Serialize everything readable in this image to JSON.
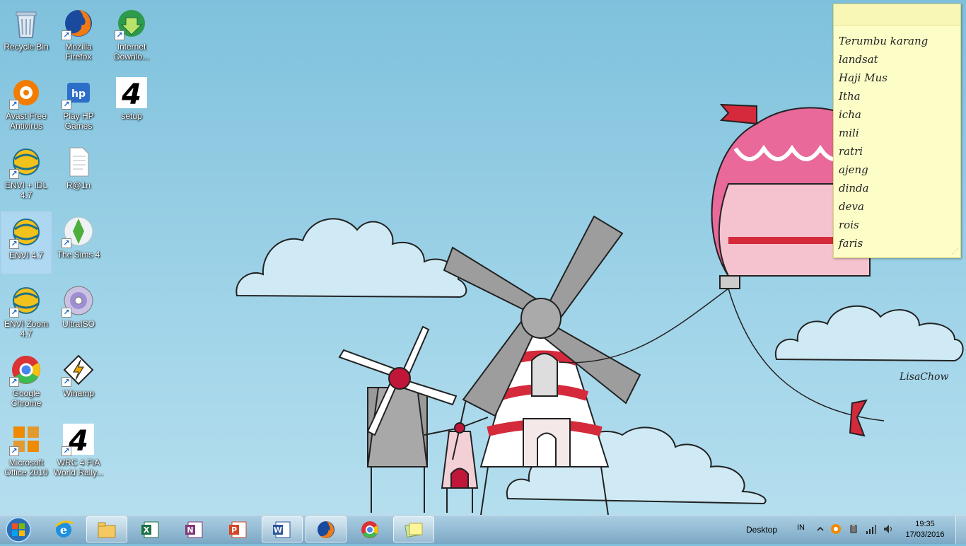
{
  "desktop": {
    "icons": [
      {
        "label": "Recycle Bin",
        "icon": "recycle-bin-icon",
        "shortcut": false
      },
      {
        "label": "Mozilla Firefox",
        "icon": "firefox-icon",
        "shortcut": true
      },
      {
        "label": "Internet Downlo...",
        "icon": "internet-download-manager-icon",
        "shortcut": true
      },
      {
        "label": "Avast Free Antivirus",
        "icon": "avast-icon",
        "shortcut": true
      },
      {
        "label": "Play HP Games",
        "icon": "hp-games-icon",
        "shortcut": true
      },
      {
        "label": "setup",
        "icon": "setup-4-icon",
        "shortcut": false
      },
      {
        "label": "ENVI + IDL 4.7",
        "icon": "envi-idl-icon",
        "shortcut": true
      },
      {
        "label": "R@1n",
        "icon": "text-file-icon",
        "shortcut": false
      },
      {
        "label": "ENVI 4.7",
        "icon": "envi-icon",
        "shortcut": true,
        "selected": true
      },
      {
        "label": "The Sims 4",
        "icon": "sims-4-icon",
        "shortcut": true
      },
      {
        "label": "ENVI Zoom 4.7",
        "icon": "envi-zoom-icon",
        "shortcut": true
      },
      {
        "label": "UltraISO",
        "icon": "ultraiso-disc-icon",
        "shortcut": true
      },
      {
        "label": "Google Chrome",
        "icon": "chrome-icon",
        "shortcut": true
      },
      {
        "label": "Winamp",
        "icon": "winamp-icon",
        "shortcut": true
      },
      {
        "label": "Microsoft Office 2010",
        "icon": "office-2010-icon",
        "shortcut": true
      },
      {
        "label": "WRC 4 FIA World Rally...",
        "icon": "wrc-4-icon",
        "shortcut": true
      }
    ]
  },
  "sticky_note": {
    "lines": [
      "Terumbu karang",
      "landsat",
      "Haji Mus",
      "Itha",
      "icha",
      "mili",
      "ratri",
      "ajeng",
      "dinda",
      "deva",
      "rois",
      "faris"
    ]
  },
  "wallpaper": {
    "signature": "LisaChow"
  },
  "taskbar": {
    "pinned": [
      {
        "name": "internet-explorer-icon"
      },
      {
        "name": "file-explorer-icon",
        "active": true
      },
      {
        "name": "excel-icon"
      },
      {
        "name": "onenote-icon"
      },
      {
        "name": "powerpoint-icon"
      },
      {
        "name": "word-icon",
        "active": true
      },
      {
        "name": "firefox-icon",
        "active": true
      },
      {
        "name": "chrome-icon"
      },
      {
        "name": "sticky-notes-icon",
        "active": true
      }
    ],
    "tray": {
      "toolbar_label": "Desktop",
      "language": "IN",
      "time": "19:35",
      "date": "17/03/2016"
    }
  },
  "colors": {
    "sky": "#9fd3e8",
    "sticky_bg": "#fdfdc8",
    "balloon_red": "#d42a3c",
    "balloon_pink": "#e8699a"
  }
}
